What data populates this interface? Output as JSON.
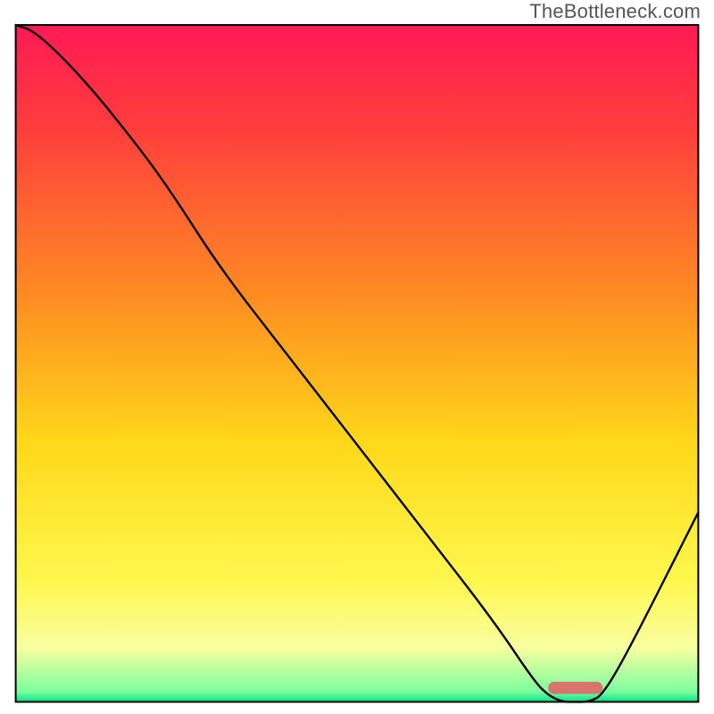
{
  "watermark": "TheBottleneck.com",
  "chart_data": {
    "type": "line",
    "title": "",
    "xlabel": "",
    "ylabel": "",
    "xlim": [
      0,
      100
    ],
    "ylim": [
      0,
      100
    ],
    "x": [
      0,
      3,
      10,
      18,
      23,
      30,
      40,
      50,
      60,
      70,
      76,
      78,
      80,
      82,
      84,
      86,
      90,
      100
    ],
    "values": [
      100,
      99,
      92,
      82,
      75,
      64,
      51,
      38,
      25,
      12,
      3,
      1,
      0,
      0,
      0,
      1,
      8,
      28
    ],
    "gradient_stops": [
      {
        "offset": 0.0,
        "color": "#ff1a55"
      },
      {
        "offset": 0.15,
        "color": "#ff3d3d"
      },
      {
        "offset": 0.4,
        "color": "#ff8c22"
      },
      {
        "offset": 0.62,
        "color": "#ffd91a"
      },
      {
        "offset": 0.82,
        "color": "#fff74d"
      },
      {
        "offset": 0.92,
        "color": "#f8ffa0"
      },
      {
        "offset": 0.985,
        "color": "#7cff9e"
      },
      {
        "offset": 1.0,
        "color": "#00e28a"
      }
    ],
    "optimal_band": {
      "x_start": 78,
      "x_end": 86,
      "color": "#d8736e",
      "thickness_frac": 0.018
    },
    "frame": {
      "left_frac": 0.022,
      "right_frac": 0.978,
      "top_frac": 0.035,
      "bottom_frac": 0.983,
      "stroke": "#000000",
      "stroke_width": 2
    },
    "line_style": {
      "stroke": "#000000",
      "stroke_width": 2.4
    }
  }
}
